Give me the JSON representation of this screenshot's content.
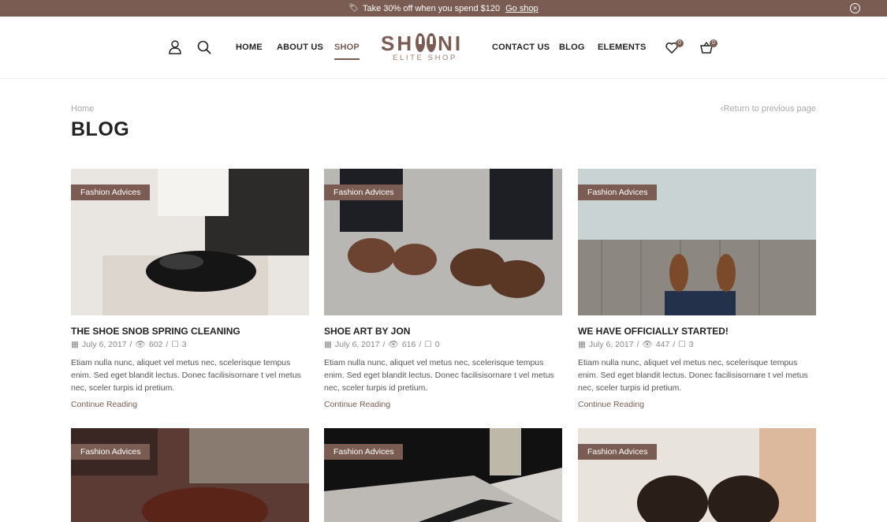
{
  "promo": {
    "text": "Take 30% off when you spend $120",
    "link": "Go shop"
  },
  "nav": {
    "home": "HOME",
    "about": "ABOUT US",
    "shop": "SHOP",
    "contact": "CONTACT US",
    "blog": "BLOG",
    "elements": "ELEMENTS"
  },
  "logo": {
    "word_left": "SH",
    "word_right": "NI",
    "sub": "ELITE SHOP"
  },
  "counts": {
    "wishlist": "0",
    "cart": "0"
  },
  "breadcrumb": {
    "home": "Home",
    "back": "Return to previous page"
  },
  "page": {
    "title": "BLOG"
  },
  "posts": [
    {
      "category": "Fashion Advices",
      "title": "THE SHOE SNOB SPRING CLEANING",
      "date": "July 6, 2017",
      "views": "602",
      "comments": "3",
      "excerpt": "Etiam nulla nunc, aliquet vel metus nec, scelerisque tempus enim. Sed eget blandit lectus. Donec facilisisornare t vel metus nec, sceler turpis id pretium.",
      "more": "Continue Reading"
    },
    {
      "category": "Fashion Advices",
      "title": "SHOE ART BY JON",
      "date": "July 6, 2017",
      "views": "616",
      "comments": "0",
      "excerpt": "Etiam nulla nunc, aliquet vel metus nec, scelerisque tempus enim. Sed eget blandit lectus. Donec facilisisornare t vel metus nec, sceler turpis id pretium.",
      "more": "Continue Reading"
    },
    {
      "category": "Fashion Advices",
      "title": "WE HAVE OFFICIALLY STARTED!",
      "date": "July 6, 2017",
      "views": "447",
      "comments": "3",
      "excerpt": "Etiam nulla nunc, aliquet vel metus nec, scelerisque tempus enim. Sed eget blandit lectus. Donec facilisisornare t vel metus nec, sceler turpis id pretium.",
      "more": "Continue Reading"
    },
    {
      "category": "Fashion Advices"
    },
    {
      "category": "Fashion Advices"
    },
    {
      "category": "Fashion Advices"
    }
  ],
  "colors": {
    "accent": "#7a5c52"
  }
}
